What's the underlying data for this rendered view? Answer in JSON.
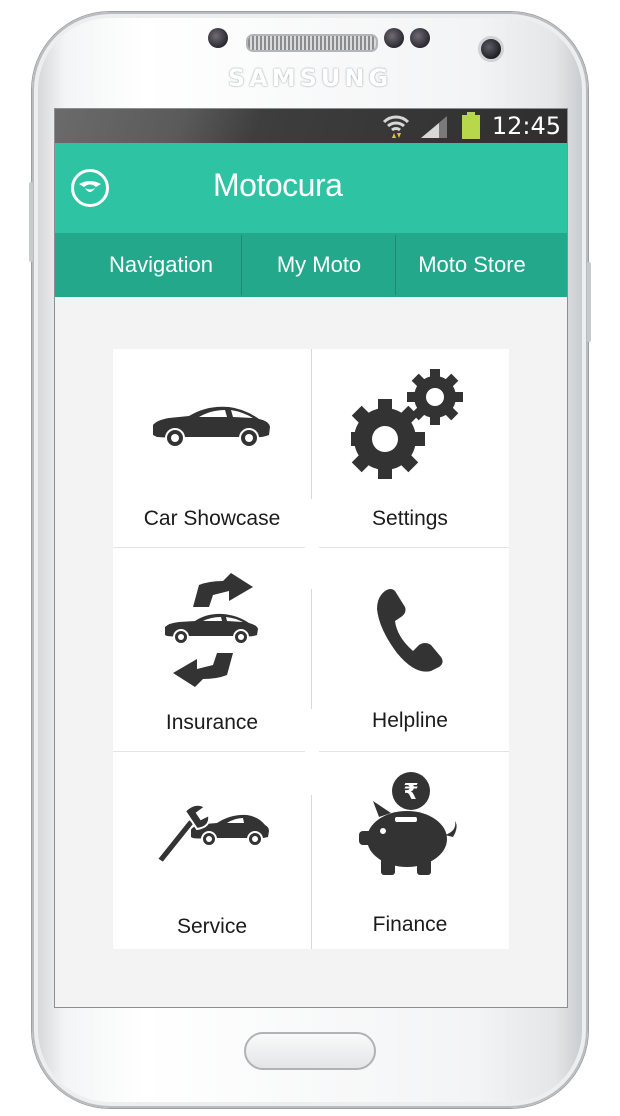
{
  "device": {
    "brand": "SAMSUNG"
  },
  "status_bar": {
    "time": "12:45"
  },
  "app_bar": {
    "title": "Motocura"
  },
  "tabs": [
    {
      "label": "Navigation"
    },
    {
      "label": "My Moto"
    },
    {
      "label": "Moto Store"
    }
  ],
  "tiles": [
    {
      "label": "Car Showcase",
      "icon": "car-icon"
    },
    {
      "label": "Settings",
      "icon": "gears-icon"
    },
    {
      "label": "Insurance",
      "icon": "insurance-icon"
    },
    {
      "label": "Helpline",
      "icon": "phone-icon"
    },
    {
      "label": "Service",
      "icon": "wrench-car-icon"
    },
    {
      "label": "Finance",
      "icon": "piggy-bank-icon"
    }
  ],
  "colors": {
    "accent": "#2ec4a3",
    "tab_bar": "#24a88c",
    "icon": "#333333"
  }
}
